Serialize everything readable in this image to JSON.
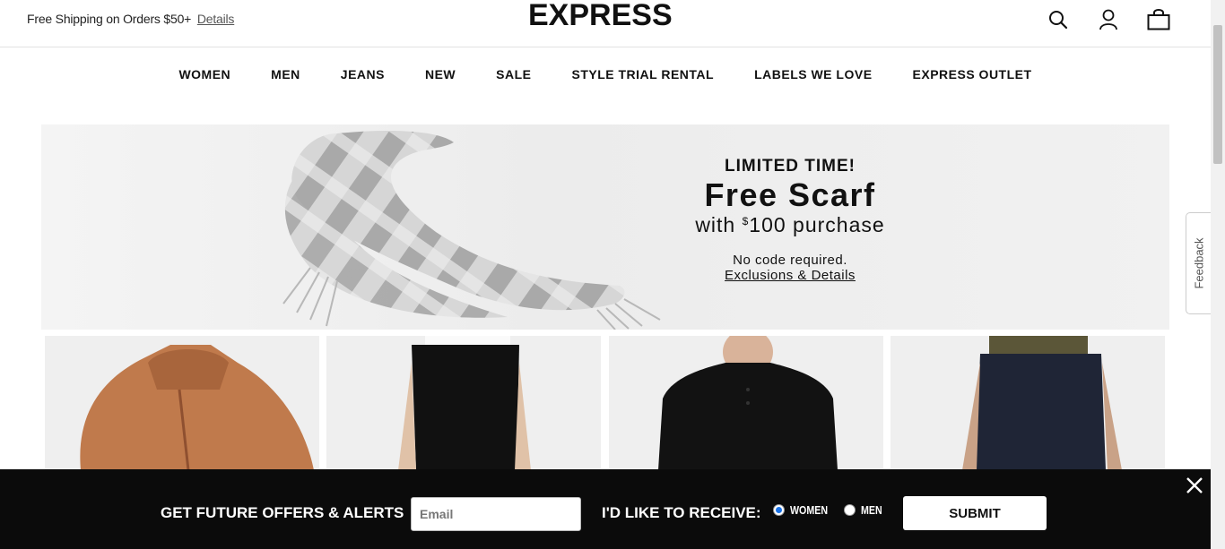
{
  "header": {
    "promo_text": "Free Shipping on Orders $50+",
    "promo_link": "Details",
    "logo": "EXPRESS",
    "icons": [
      "search-icon",
      "account-icon",
      "bag-icon"
    ]
  },
  "nav": {
    "items": [
      {
        "label": "WOMEN"
      },
      {
        "label": "MEN"
      },
      {
        "label": "JEANS"
      },
      {
        "label": "NEW"
      },
      {
        "label": "SALE"
      },
      {
        "label": "STYLE TRIAL RENTAL"
      },
      {
        "label": "LABELS WE LOVE"
      },
      {
        "label": "EXPRESS OUTLET"
      }
    ]
  },
  "hero": {
    "line1": "LIMITED TIME!",
    "line2": "Free Scarf",
    "line3_prefix": "with ",
    "line3_sup": "$",
    "line3_amount": "100 purchase",
    "line4": "No code required.",
    "link": "Exclusions & Details"
  },
  "products": [
    {
      "name": "faux-fur-jacket"
    },
    {
      "name": "black-pants"
    },
    {
      "name": "black-henley"
    },
    {
      "name": "dark-jeans"
    }
  ],
  "feedback": {
    "label": "Feedback"
  },
  "signup": {
    "title": "GET FUTURE OFFERS & ALERTS",
    "email_placeholder": "Email",
    "receive_label": "I'D LIKE TO RECEIVE:",
    "options": [
      {
        "label": "WOMEN",
        "selected": true
      },
      {
        "label": "MEN",
        "selected": false
      }
    ],
    "submit_label": "SUBMIT"
  },
  "colors": {
    "accent": "#1a73e8",
    "banner_bg": "#0b0b0b"
  }
}
